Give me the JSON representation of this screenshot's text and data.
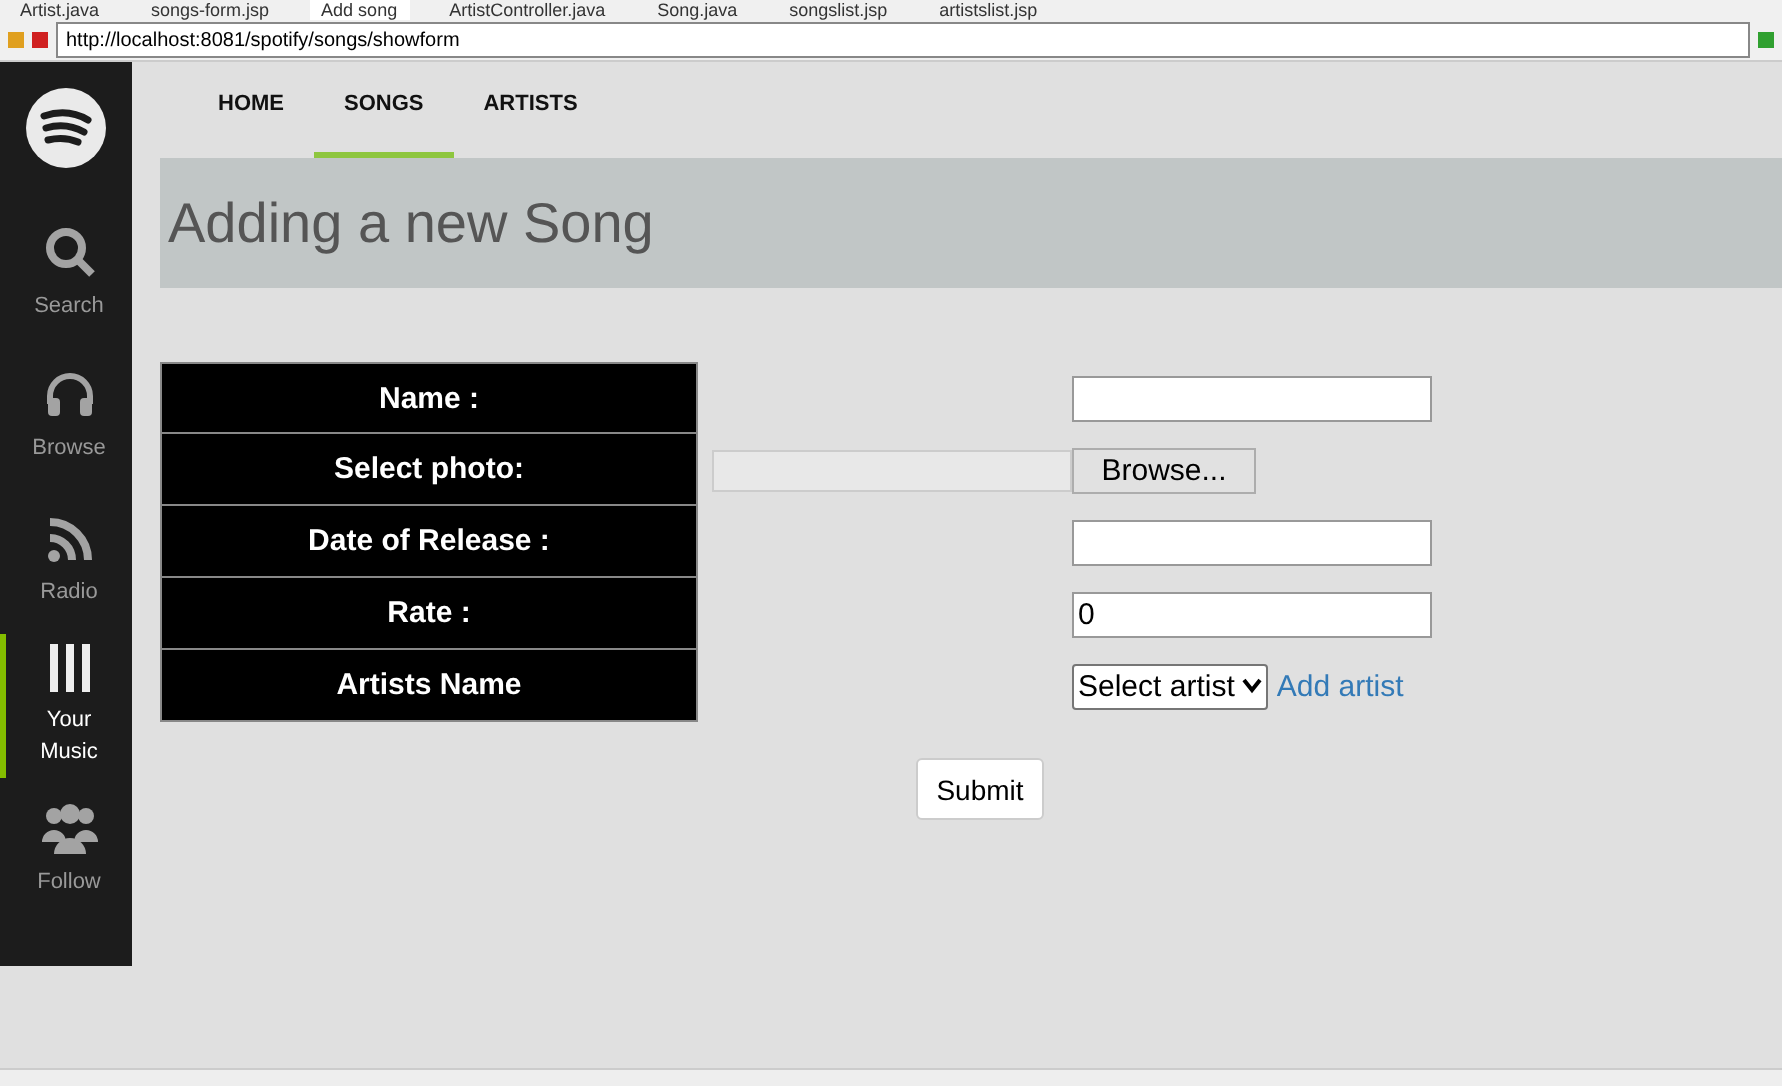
{
  "editor_tabs": [
    {
      "label": "Artist.java",
      "selected": false
    },
    {
      "label": "songs-form.jsp",
      "selected": false
    },
    {
      "label": "Add song",
      "selected": true
    },
    {
      "label": "ArtistController.java",
      "selected": false
    },
    {
      "label": "Song.java",
      "selected": false
    },
    {
      "label": "songslist.jsp",
      "selected": false
    },
    {
      "label": "artistslist.jsp",
      "selected": false
    }
  ],
  "url": "http://localhost:8081/spotify/songs/showform",
  "sidebar": {
    "items": [
      {
        "kind": "search",
        "label": "Search",
        "selected": false
      },
      {
        "kind": "browse",
        "label": "Browse",
        "selected": false
      },
      {
        "kind": "radio",
        "label": "Radio",
        "selected": false
      },
      {
        "kind": "music",
        "label": "Your Music",
        "selected": true
      },
      {
        "kind": "follow",
        "label": "Follow",
        "selected": false
      }
    ]
  },
  "nav": [
    {
      "label": "HOME",
      "selected": false
    },
    {
      "label": "SONGS",
      "selected": true
    },
    {
      "label": "ARTISTS",
      "selected": false
    }
  ],
  "title": "Adding a new Song",
  "form": {
    "rows": [
      {
        "kind": "text",
        "label": "Name :",
        "value": ""
      },
      {
        "kind": "file",
        "label": "Select photo:",
        "button": "Browse..."
      },
      {
        "kind": "text",
        "label": "Date of Release :",
        "value": ""
      },
      {
        "kind": "text",
        "label": "Rate :",
        "value": "0"
      },
      {
        "kind": "select",
        "label": "Artists Name",
        "value": "Select artist",
        "link": "Add artist"
      }
    ],
    "submit": "Submit"
  }
}
